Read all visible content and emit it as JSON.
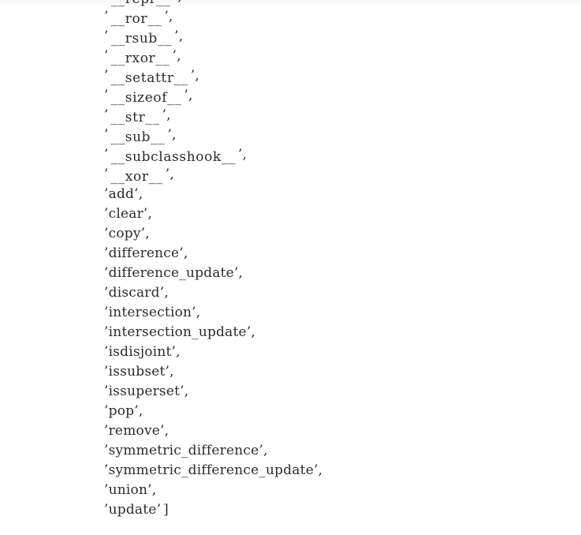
{
  "document": {
    "kind": "python-repr-output",
    "background_color": "#ffffff",
    "text_color": "#2b2b2b",
    "top_band_color": "#f7f7f8"
  },
  "listing": {
    "closing_bracket": "]",
    "separator": ",",
    "quote_open": "’",
    "quote_close": "’",
    "lines": [
      {
        "name": "__repr__",
        "dunder": true,
        "trailing": ","
      },
      {
        "name": "__ror__",
        "dunder": true,
        "trailing": ","
      },
      {
        "name": "__rsub__",
        "dunder": true,
        "trailing": ","
      },
      {
        "name": "__rxor__",
        "dunder": true,
        "trailing": ","
      },
      {
        "name": "__setattr__",
        "dunder": true,
        "trailing": ","
      },
      {
        "name": "__sizeof__",
        "dunder": true,
        "trailing": ","
      },
      {
        "name": "__str__",
        "dunder": true,
        "trailing": ","
      },
      {
        "name": "__sub__",
        "dunder": true,
        "trailing": ","
      },
      {
        "name": "__subclasshook__",
        "dunder": true,
        "trailing": ","
      },
      {
        "name": "__xor__",
        "dunder": true,
        "trailing": ","
      },
      {
        "name": "add",
        "dunder": false,
        "trailing": ","
      },
      {
        "name": "clear",
        "dunder": false,
        "trailing": ","
      },
      {
        "name": "copy",
        "dunder": false,
        "trailing": ","
      },
      {
        "name": "difference",
        "dunder": false,
        "trailing": ","
      },
      {
        "name": "difference_update",
        "dunder": false,
        "trailing": ","
      },
      {
        "name": "discard",
        "dunder": false,
        "trailing": ","
      },
      {
        "name": "intersection",
        "dunder": false,
        "trailing": ","
      },
      {
        "name": "intersection_update",
        "dunder": false,
        "trailing": ","
      },
      {
        "name": "isdisjoint",
        "dunder": false,
        "trailing": ","
      },
      {
        "name": "issubset",
        "dunder": false,
        "trailing": ","
      },
      {
        "name": "issuperset",
        "dunder": false,
        "trailing": ","
      },
      {
        "name": "pop",
        "dunder": false,
        "trailing": ","
      },
      {
        "name": "remove",
        "dunder": false,
        "trailing": ","
      },
      {
        "name": "symmetric_difference",
        "dunder": false,
        "trailing": ","
      },
      {
        "name": "symmetric_difference_update",
        "dunder": false,
        "trailing": ","
      },
      {
        "name": "union",
        "dunder": false,
        "trailing": ","
      },
      {
        "name": "update",
        "dunder": false,
        "trailing": "]"
      }
    ]
  }
}
